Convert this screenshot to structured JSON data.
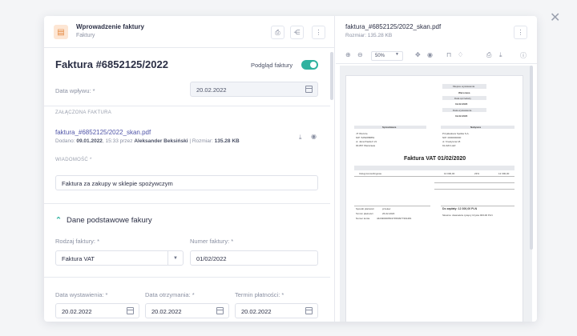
{
  "window": {
    "close_icon": "close-icon"
  },
  "left": {
    "header": {
      "title": "Wprowadzenie faktury",
      "subtitle": "Faktury"
    },
    "invoice_title": "Faktura #6852125/2022",
    "preview_toggle_label": "Podgląd faktury",
    "received_date_label": "Data wpływu: *",
    "received_date_value": "20.02.2022",
    "attached_label": "ZAŁĄCZONA FAKTURA",
    "file_name": "faktura_#6852125/2022_skan.pdf",
    "file_added_prefix": "Dodano: ",
    "file_added_date": "09.01.2022",
    "file_added_mid": ", 15:33 przez ",
    "file_added_author": "Aleksander Beksiński",
    "file_size_prefix": " | Rozmiar: ",
    "file_size": "135.28 KB",
    "message_label": "WIADOMOŚĆ *",
    "message_value": "Faktura za zakupy w sklepie spożywczym",
    "section_title": "Dane podstawowe fakury",
    "invoice_type_label": "Rodzaj faktury: *",
    "invoice_type_value": "Faktura VAT",
    "invoice_number_label": "Numer faktury: *",
    "invoice_number_value": "01/02/2022",
    "issue_date_label": "Data wystawienia: *",
    "issue_date_value": "20.02.2022",
    "receipt_date_label": "Data otrzymania: *",
    "receipt_date_value": "20.02.2022",
    "payment_due_label": "Termin płatności: *",
    "payment_due_value": "20.02.2022"
  },
  "right": {
    "file_name": "faktura_#6852125/2022_skan.pdf",
    "size_label": "Rozmiar: 135.28 KB",
    "zoom_value": "50%"
  },
  "doc": {
    "place_label": "Miejsce wystawienia",
    "place": "Warszawa",
    "sale_label": "Data sprzedaży",
    "sale_date": "19-02-2020",
    "issue_label": "Data wystawienia",
    "issue_date": "19-02-2020",
    "seller_h": "Sprzedawca",
    "seller_1": "JT Wszcze",
    "seller_2": "NIP: 5252058851",
    "seller_3": "ul. Jana Pawła II 21",
    "seller_4": "00-867 Warszawa",
    "buyer_h": "Nabywca",
    "buyer_1": "Przykładowa Spółka S.A.",
    "buyer_2": "NIP: 0000000000",
    "buyer_3": "ul. Kreatywna 18",
    "buyer_4": "91-020 Łódź",
    "title": "Faktura VAT 01/02/2020",
    "row_item": "Usługi konsultingowe",
    "row_net": "10 000,00",
    "row_vat": "23%",
    "row_gross": "12 300,00",
    "pay_label": "Sposób płatności",
    "pay": "przelew",
    "due_label": "Termin płatności",
    "due": "26-02-2020",
    "acct_label": "Numer konta",
    "acct": "44249000050474560977391481",
    "total_label": "Do zapłaty: 12 300,00 PLN",
    "words": "Słownie: dwanaście tysięcy trzysta 00/100 PLN"
  }
}
